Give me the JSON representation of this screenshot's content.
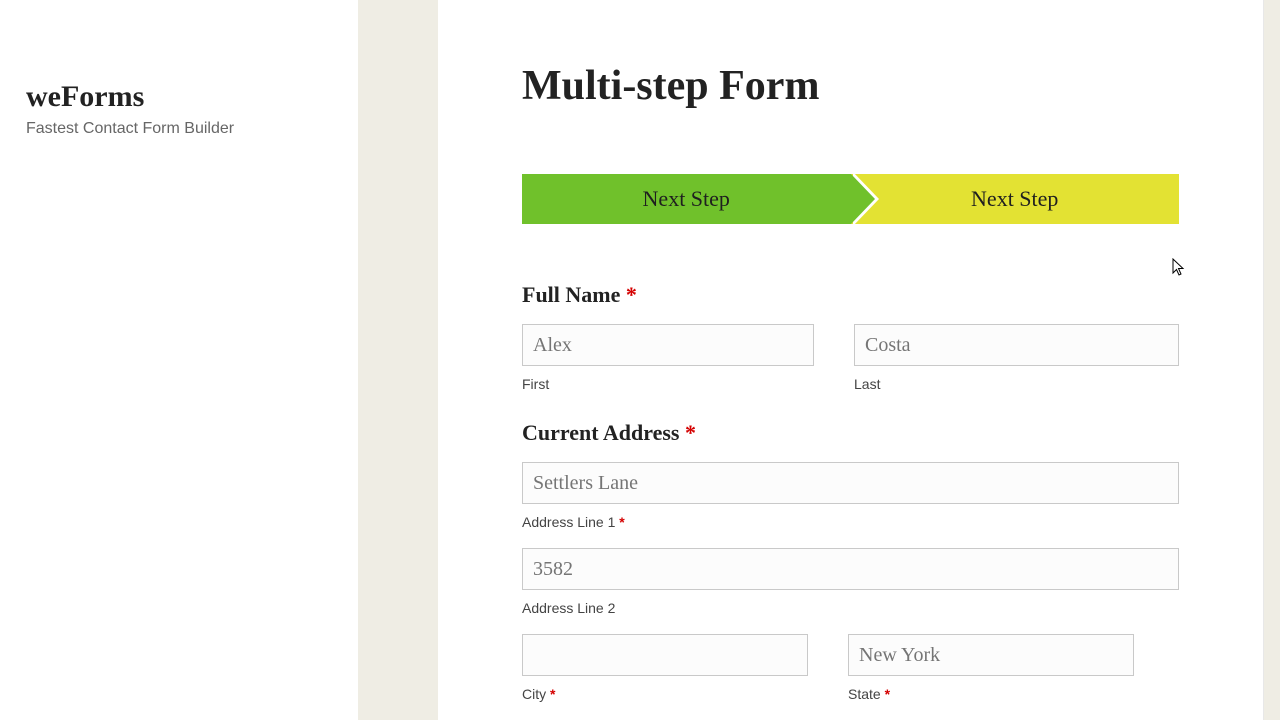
{
  "site": {
    "title": "weForms",
    "tagline": "Fastest Contact Form Builder"
  },
  "page": {
    "title": "Multi-step Form"
  },
  "steps": [
    {
      "label": "Next Step"
    },
    {
      "label": "Next Step"
    }
  ],
  "fields": {
    "full_name": {
      "label": "Full Name",
      "required": "*",
      "first": {
        "placeholder": "Alex",
        "sub": "First"
      },
      "last": {
        "placeholder": "Costa",
        "sub": "Last"
      }
    },
    "address": {
      "label": "Current Address",
      "required": "*",
      "line1": {
        "placeholder": "Settlers Lane",
        "sub": "Address Line 1",
        "req": "*"
      },
      "line2": {
        "placeholder": "3582",
        "sub": "Address Line 2"
      },
      "city": {
        "placeholder": "",
        "sub": "City",
        "req": "*"
      },
      "state": {
        "placeholder": "New York",
        "sub": "State",
        "req": "*"
      }
    }
  }
}
